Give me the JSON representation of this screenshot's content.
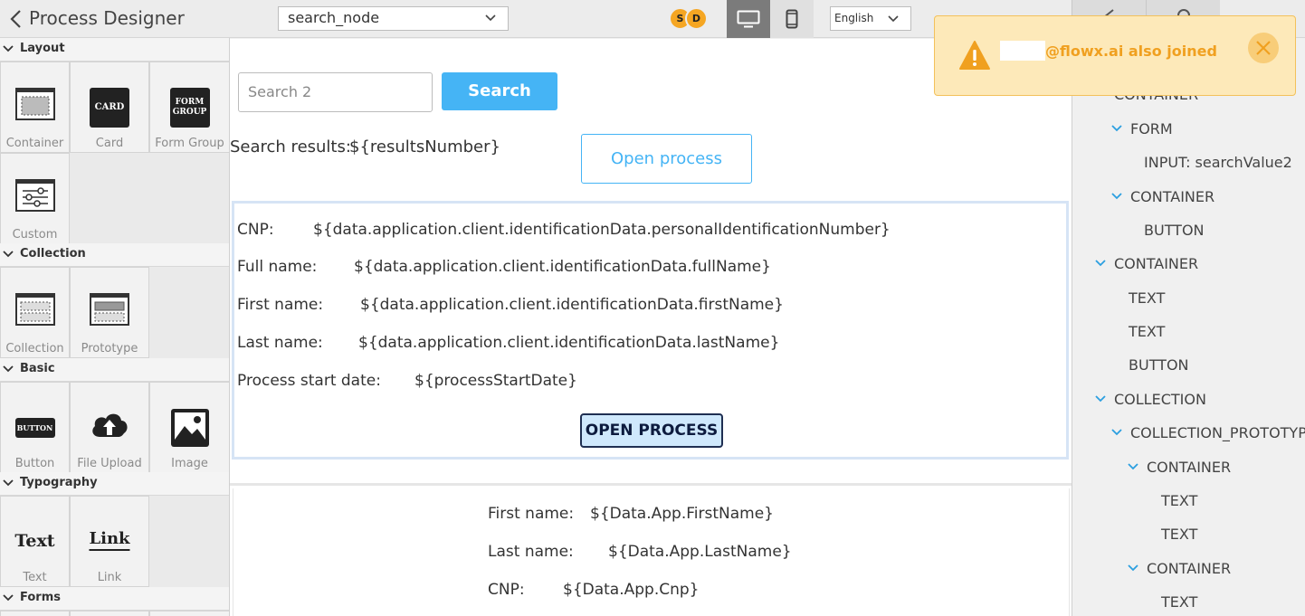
{
  "header": {
    "title": "Process Designer",
    "node_select_value": "search_node",
    "avatars": [
      "S",
      "D"
    ],
    "language": "English"
  },
  "palette": {
    "sections": {
      "layout": "Layout",
      "collection": "Collection",
      "basic": "Basic",
      "typography": "Typography",
      "forms": "Forms"
    },
    "tiles": {
      "container": "Container",
      "card": "Card",
      "form_group": "Form Group",
      "custom": "Custom",
      "collection": "Collection",
      "prototype": "Prototype",
      "button": "Button",
      "file_upload": "File Upload",
      "image": "Image",
      "text": "Text",
      "link": "Link"
    },
    "tile_glyphs": {
      "card": "CARD",
      "form_group_line1": "FORM",
      "form_group_line2": "GROUP",
      "button": "BUTTON",
      "text": "Text",
      "link": "Link"
    }
  },
  "canvas": {
    "search_placeholder": "Search 2",
    "search_button": "Search",
    "results_label": "Search results:",
    "results_value": "${resultsNumber}",
    "open_process_outline": "Open process",
    "detail": {
      "rows": [
        {
          "label": "CNP:",
          "value": "${data.application.client.identificationData.personalIdentificationNumber}"
        },
        {
          "label": "Full name:",
          "value": "${data.application.client.identificationData.fullName}"
        },
        {
          "label": "First name:",
          "value": "${data.application.client.identificationData.firstName}"
        },
        {
          "label": "Last name:",
          "value": "${data.application.client.identificationData.lastName}"
        },
        {
          "label": "Process start date:",
          "value": "${processStartDate}"
        }
      ],
      "open_process_button": "OPEN PROCESS"
    },
    "prototype": {
      "rows": [
        {
          "label": "First name:",
          "value": "${Data.App.FirstName}"
        },
        {
          "label": "Last name:",
          "value": "${Data.App.LastName}"
        },
        {
          "label": "CNP:",
          "value": "${Data.App.Cnp}"
        }
      ]
    }
  },
  "tree": {
    "items": [
      "CONTAINER",
      "FORM",
      "INPUT: searchValue2",
      "CONTAINER",
      "BUTTON",
      "CONTAINER",
      "TEXT",
      "TEXT",
      "BUTTON",
      "COLLECTION",
      "COLLECTION_PROTOTYPE",
      "CONTAINER",
      "TEXT",
      "TEXT",
      "CONTAINER",
      "TEXT"
    ]
  },
  "toast": {
    "message": "@flowx.ai also joined"
  },
  "colors": {
    "accent": "#45b4f5",
    "toast_bg": "#fde9b9",
    "toast_text": "#f0a020",
    "tree_chevron": "#2b9fe0"
  }
}
